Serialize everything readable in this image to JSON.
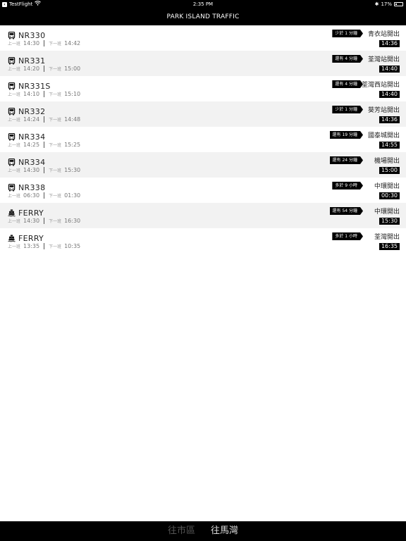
{
  "status_bar": {
    "app_back": "TestFlight",
    "time": "2:35 PM",
    "bluetooth": "✱",
    "battery": "17%"
  },
  "header": {
    "title": "PARK ISLAND TRAFFIC"
  },
  "labels": {
    "prev": "上一班",
    "next": "下一班"
  },
  "routes": [
    {
      "icon": "bus-icon",
      "name": "NR330",
      "prev": "14:30",
      "next": "14:42",
      "badge": "少於 1 分鐘",
      "dest": "青衣站開出",
      "depart": "14:36"
    },
    {
      "icon": "bus-icon",
      "name": "NR331",
      "prev": "14:20",
      "next": "15:00",
      "badge": "還有 4 分鐘",
      "dest": "荃灣站開出",
      "depart": "14:40"
    },
    {
      "icon": "bus-icon",
      "name": "NR331S",
      "prev": "14:10",
      "next": "15:10",
      "badge": "還有 4 分鐘",
      "dest": "荃灣西站開出",
      "depart": "14:40"
    },
    {
      "icon": "bus-icon",
      "name": "NR332",
      "prev": "14:24",
      "next": "14:48",
      "badge": "少於 1 分鐘",
      "dest": "葵芳站開出",
      "depart": "14:36"
    },
    {
      "icon": "bus-icon",
      "name": "NR334",
      "prev": "14:25",
      "next": "15:25",
      "badge": "還有 19 分鐘",
      "dest": "國泰城開出",
      "depart": "14:55"
    },
    {
      "icon": "bus-icon",
      "name": "NR334",
      "prev": "14:30",
      "next": "15:30",
      "badge": "還有 24 分鐘",
      "dest": "機場開出",
      "depart": "15:00"
    },
    {
      "icon": "bus-icon",
      "name": "NR338",
      "prev": "06:30",
      "next": "01:30",
      "badge": "多於 9 小時",
      "dest": "中環開出",
      "depart": "00:30"
    },
    {
      "icon": "ferry-icon",
      "name": "FERRY",
      "prev": "14:30",
      "next": "16:30",
      "badge": "還有 54 分鐘",
      "dest": "中環開出",
      "depart": "15:30"
    },
    {
      "icon": "ferry-icon",
      "name": "FERRY",
      "prev": "13:35",
      "next": "10:35",
      "badge": "多於 1 小時",
      "dest": "荃灣開出",
      "depart": "16:35"
    }
  ],
  "tabs": [
    {
      "label": "往市區",
      "active": false
    },
    {
      "label": "往馬灣",
      "active": true
    }
  ]
}
